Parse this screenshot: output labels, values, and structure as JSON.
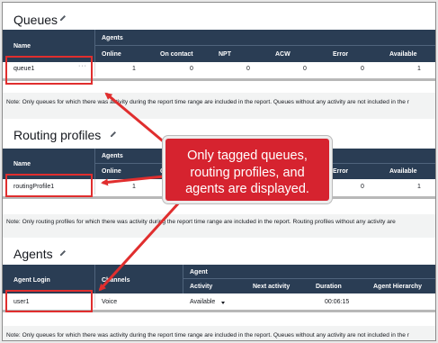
{
  "queues": {
    "title": "Queues",
    "header_name": "Name",
    "header_group": "Agents",
    "columns": [
      "Online",
      "On contact",
      "NPT",
      "ACW",
      "Error",
      "Available"
    ],
    "row": {
      "name": "queue1",
      "values": [
        "1",
        "0",
        "0",
        "0",
        "0",
        "1"
      ]
    },
    "note": "Note: Only queues for which there was activity during the report time range are included in the report. Queues without any activity are not included in the r"
  },
  "routing": {
    "title": "Routing profiles",
    "header_name": "Name",
    "header_group": "Agents",
    "columns": [
      "Online",
      "O",
      "Error",
      "Available"
    ],
    "row": {
      "name": "routingProfile1",
      "values": [
        "1",
        "0",
        "1"
      ]
    },
    "note": "Note: Only routing profiles for which there was activity during the report time range are included in the report. Routing profiles without any activity are"
  },
  "agents": {
    "title": "Agents",
    "header_login": "Agent Login",
    "header_channels": "Channels",
    "header_group": "Agent",
    "columns": [
      "Activity",
      "Next activity",
      "Duration",
      "Agent Hierarchy"
    ],
    "row": {
      "login": "user1",
      "channel": "Voice",
      "activity": "Available",
      "duration": "00:06:15"
    },
    "note": "Note: Only queues for which there was activity during the report time range are included in the report. Queues without any activity are not included in the r"
  },
  "callout": {
    "lines": [
      "Only tagged queues,",
      "routing profiles, and",
      "agents are displayed."
    ],
    "color": "#d6232f"
  },
  "icons": [
    "pencil-icon",
    "more-options-icon",
    "dropdown-caret-icon",
    "arrow"
  ]
}
